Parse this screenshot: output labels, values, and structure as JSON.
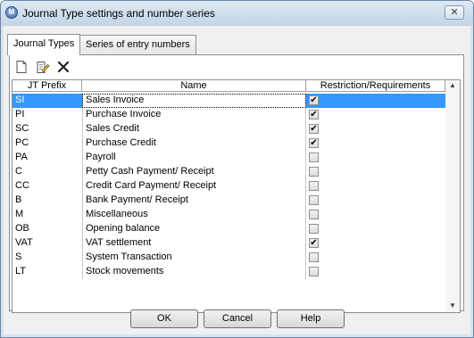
{
  "window": {
    "title": "Journal Type settings and number series",
    "close_glyph": "✕"
  },
  "tabs": [
    {
      "label": "Journal Types",
      "active": true
    },
    {
      "label": "Series of entry numbers",
      "active": false
    }
  ],
  "toolbar": {
    "icons": [
      "new-document-icon",
      "edit-document-icon",
      "delete-icon"
    ]
  },
  "grid": {
    "columns": [
      "JT Prefix",
      "Name",
      "Restriction/Requirements"
    ],
    "selected_index": 0,
    "rows": [
      {
        "prefix": "SI",
        "name": "Sales Invoice",
        "restricted": true
      },
      {
        "prefix": "PI",
        "name": "Purchase Invoice",
        "restricted": true
      },
      {
        "prefix": "SC",
        "name": "Sales Credit",
        "restricted": true
      },
      {
        "prefix": "PC",
        "name": "Purchase Credit",
        "restricted": true
      },
      {
        "prefix": "PA",
        "name": "Payroll",
        "restricted": false
      },
      {
        "prefix": "C",
        "name": "Petty Cash Payment/ Receipt",
        "restricted": false
      },
      {
        "prefix": "CC",
        "name": "Credit Card Payment/ Receipt",
        "restricted": false
      },
      {
        "prefix": "B",
        "name": "Bank Payment/ Receipt",
        "restricted": false
      },
      {
        "prefix": "M",
        "name": "Miscellaneous",
        "restricted": false
      },
      {
        "prefix": "OB",
        "name": "Opening balance",
        "restricted": false
      },
      {
        "prefix": "VAT",
        "name": "VAT settlement",
        "restricted": true
      },
      {
        "prefix": "S",
        "name": "System Transaction",
        "restricted": false
      },
      {
        "prefix": "LT",
        "name": "Stock movements",
        "restricted": false
      }
    ]
  },
  "buttons": {
    "ok": "OK",
    "cancel": "Cancel",
    "help": "Help"
  },
  "colors": {
    "selection": "#3399ff",
    "title_bar": "#c4d4e6"
  }
}
